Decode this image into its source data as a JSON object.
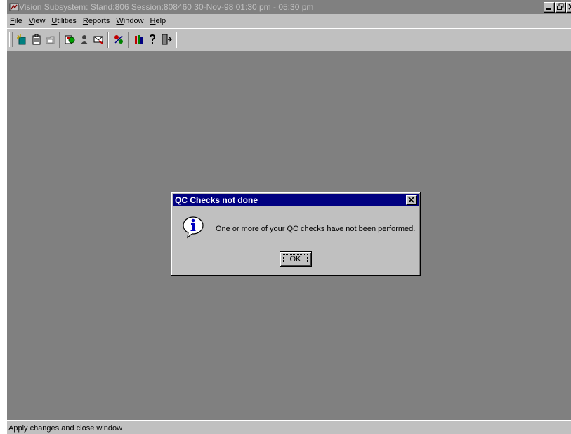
{
  "window": {
    "title": "Vision Subsystem: Stand:806 Session:808460 30-Nov-98 01:30 pm - 05:30 pm",
    "controls": [
      "minimize-icon",
      "restore-icon",
      "close-icon"
    ]
  },
  "menu": {
    "items": [
      {
        "label": "File"
      },
      {
        "label": "View"
      },
      {
        "label": "Utilities"
      },
      {
        "label": "Reports"
      },
      {
        "label": "Window"
      },
      {
        "label": "Help"
      }
    ]
  },
  "toolbar": {
    "buttons": [
      "new-consultation-icon",
      "clipboard-icon",
      "folder-icon",
      "patient-select-icon",
      "user-icon",
      "mail-icon",
      "transfer-icon",
      "library-icon",
      "help-icon",
      "exit-icon"
    ]
  },
  "dialog": {
    "title": "QC Checks not done",
    "message": "One or more of your QC checks have not been performed.",
    "ok_label": "OK",
    "icon": "info-icon"
  },
  "status": {
    "text": "Apply changes and close window"
  },
  "colors": {
    "workspace": "#808080",
    "inactive_title": "#808080",
    "dialog_title": "#000080",
    "face": "#c0c0c0"
  }
}
